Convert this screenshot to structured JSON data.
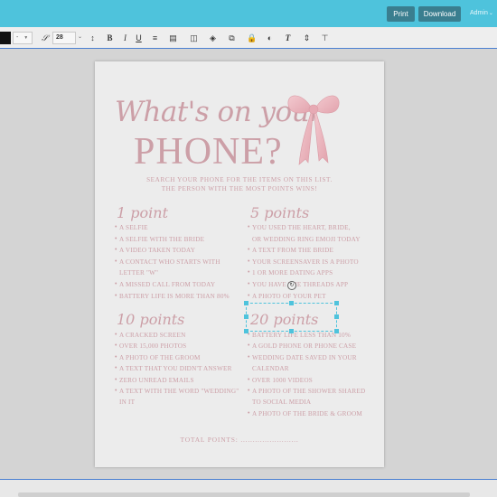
{
  "topbar": {
    "print_label": "Print",
    "download_label": "Download",
    "user_label": "Admin",
    "accent": "#4ec3dc"
  },
  "toolbar": {
    "line_style_value": "-",
    "font_size_value": "28",
    "icons": [
      "text-style-icon",
      "line-height-icon",
      "bold-icon",
      "italic-icon",
      "underline-icon",
      "align-icon",
      "replace-image-icon",
      "layers-icon",
      "stack-icon",
      "lock-icon",
      "opacity-icon",
      "text-transform-icon",
      "spacing-icon",
      "crop-icon"
    ]
  },
  "document": {
    "title_line1": "What's on your",
    "title_line2": "PHONE?",
    "subtitle_line1": "SEARCH YOUR PHONE FOR THE ITEMS ON THIS LIST.",
    "subtitle_line2": "THE PERSON WITH THE MOST POINTS WINS!",
    "sections": [
      {
        "heading": "1 point",
        "items": [
          "A SELFIE",
          "A SELFIE WITH THE BRIDE",
          "A VIDEO TAKEN TODAY",
          "A CONTACT WHO STARTS WITH",
          "LETTER \"W\"",
          "A MISSED CALL FROM TODAY",
          "BATTERY LIFE IS MORE THAN 80%"
        ]
      },
      {
        "heading": "5 points",
        "items": [
          "YOU USED THE HEART, BRIDE,",
          "OR WEDDING RING EMOJI TODAY",
          "A TEXT FROM THE BRIDE",
          "YOUR SCREENSAVER IS A PHOTO",
          "1 OR MORE DATING APPS",
          "YOU HAVE THE THREADS APP",
          "A PHOTO OF YOUR PET"
        ]
      },
      {
        "heading": "10 points",
        "items": [
          "A CRACKED SCREEN",
          "OVER 15,000 PHOTOS",
          "A PHOTO OF THE GROOM",
          "A TEXT THAT YOU DIDN'T ANSWER",
          "ZERO UNREAD EMAILS",
          "A TEXT WITH THE WORD \"WEDDING\"",
          "IN IT"
        ]
      },
      {
        "heading": "20 points",
        "items": [
          "BATTERY LIFE LESS THAN 10%",
          "A GOLD PHONE OR PHONE CASE",
          "WEDDING DATE SAVED IN  YOUR",
          "CALENDAR",
          "OVER 1000 VIDEOS",
          "A PHOTO OF THE SHOWER SHARED",
          "TO SOCIAL MEDIA",
          "A PHOTO OF THE BRIDE & GROOM"
        ]
      }
    ],
    "total_label": "TOTAL POINTS: ........................",
    "text_color": "#cc9fa7"
  }
}
